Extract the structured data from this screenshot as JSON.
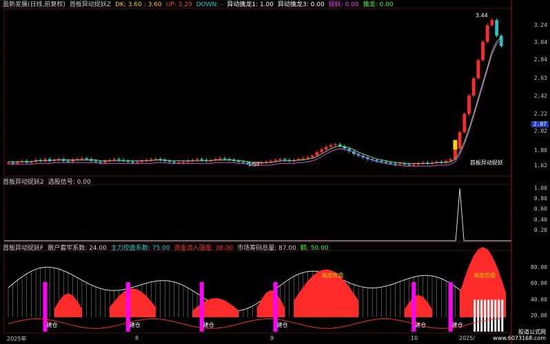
{
  "colors": {
    "up": "#ff2a2a",
    "down": "#22c6c6",
    "ma": "#d94cd9",
    "ma2": "#7ddc7d",
    "grid": "#5a1010",
    "text": "#c8c8c8",
    "magenta": "#ff00ff",
    "yellow": "#ffd000"
  },
  "panel1": {
    "header": [
      {
        "text": "盈新发展(日线,前复权)",
        "color": "#d0d0d0"
      },
      {
        "text": "首板异动捉妖Z",
        "color": "#d0d0d0"
      },
      {
        "text": "DK: 3.60 : 3.60",
        "color": "#ffd000"
      },
      {
        "text": "UP: 3.29",
        "color": "#ff4040"
      },
      {
        "text": "DOWN: -",
        "color": "#22d0d0"
      },
      {
        "text": "异动擒龙1: 1.00",
        "color": "#ffffff"
      },
      {
        "text": "异动擒龙3: 0.00",
        "color": "#ffffff"
      },
      {
        "text": "捉妖: 0.00",
        "color": "#ff40ff"
      },
      {
        "text": "擒龙: 0.00",
        "color": "#40ff40"
      }
    ],
    "price_label": "2.07",
    "peak_label": "3.44",
    "low_label": "1.57",
    "annotation": "首板异动捉妖"
  },
  "panel2": {
    "header": [
      {
        "text": "首板异动捉妖2",
        "color": "#d0d0d0"
      },
      {
        "text": "选股信号: 0.00",
        "color": "#d0d0d0"
      }
    ]
  },
  "panel3": {
    "header": [
      {
        "text": "首板异动捉妖F",
        "color": "#d0d0d0"
      },
      {
        "text": "散户套牢系数: 24.00",
        "color": "#d0d0d0"
      },
      {
        "text": "主力控盘系数: 75.00",
        "color": "#22d0d0"
      },
      {
        "text": "资金流入强度: 38.00",
        "color": "#ff3030"
      },
      {
        "text": "市场筹码总量: 87.00",
        "color": "#d0d0d0"
      },
      {
        "text": "鹤: 50.00",
        "color": "#40ff40"
      }
    ],
    "label_hot1": "高度控盘",
    "label_hot2": "高度控盘",
    "build_label": "建仓"
  },
  "x_axis": [
    "2025年",
    "8",
    "9",
    "10",
    "2025/"
  ],
  "watermark": [
    "股道公式网",
    "www.6073168.com"
  ],
  "chart_data": [
    {
      "type": "candlestick",
      "y_ticks": [
        1.62,
        1.8,
        2.02,
        2.22,
        2.42,
        2.63,
        2.84,
        3.04,
        3.24
      ],
      "ylim": [
        1.52,
        3.42
      ],
      "close": [
        1.66,
        1.65,
        1.67,
        1.68,
        1.66,
        1.67,
        1.69,
        1.68,
        1.7,
        1.68,
        1.69,
        1.7,
        1.68,
        1.67,
        1.69,
        1.7,
        1.71,
        1.7,
        1.68,
        1.67,
        1.66,
        1.68,
        1.69,
        1.7,
        1.69,
        1.68,
        1.67,
        1.66,
        1.67,
        1.68,
        1.69,
        1.7,
        1.7,
        1.69,
        1.68,
        1.67,
        1.66,
        1.66,
        1.67,
        1.68,
        1.69,
        1.7,
        1.69,
        1.68,
        1.69,
        1.7,
        1.71,
        1.7,
        1.69,
        1.68,
        1.67,
        1.66,
        1.65,
        1.64,
        1.65,
        1.66,
        1.67,
        1.68,
        1.69,
        1.7,
        1.69,
        1.68,
        1.69,
        1.7,
        1.71,
        1.72,
        1.74,
        1.78,
        1.81,
        1.84,
        1.86,
        1.87,
        1.85,
        1.82,
        1.79,
        1.76,
        1.74,
        1.72,
        1.7,
        1.69,
        1.68,
        1.67,
        1.66,
        1.65,
        1.64,
        1.65,
        1.64,
        1.63,
        1.64,
        1.65,
        1.66,
        1.65,
        1.66,
        1.67,
        1.66,
        1.68,
        1.7,
        1.82,
        2.01,
        2.22,
        2.43,
        2.63,
        2.84,
        3.05,
        3.24,
        3.3,
        3.12,
        3.0
      ],
      "ma": [
        1.67,
        1.67,
        1.67,
        1.67,
        1.67,
        1.67,
        1.68,
        1.68,
        1.68,
        1.68,
        1.69,
        1.69,
        1.69,
        1.69,
        1.69,
        1.69,
        1.69,
        1.69,
        1.69,
        1.69,
        1.68,
        1.68,
        1.68,
        1.68,
        1.68,
        1.68,
        1.68,
        1.68,
        1.68,
        1.68,
        1.68,
        1.68,
        1.69,
        1.69,
        1.69,
        1.68,
        1.68,
        1.68,
        1.68,
        1.68,
        1.68,
        1.68,
        1.68,
        1.68,
        1.68,
        1.69,
        1.69,
        1.69,
        1.69,
        1.69,
        1.68,
        1.68,
        1.67,
        1.66,
        1.66,
        1.66,
        1.66,
        1.66,
        1.67,
        1.68,
        1.68,
        1.68,
        1.68,
        1.69,
        1.69,
        1.7,
        1.71,
        1.73,
        1.76,
        1.79,
        1.82,
        1.84,
        1.85,
        1.84,
        1.83,
        1.81,
        1.78,
        1.76,
        1.74,
        1.72,
        1.7,
        1.69,
        1.68,
        1.67,
        1.66,
        1.66,
        1.65,
        1.65,
        1.65,
        1.65,
        1.65,
        1.65,
        1.65,
        1.66,
        1.66,
        1.66,
        1.67,
        1.7,
        1.78,
        1.9,
        2.05,
        2.22,
        2.4,
        2.58,
        2.76,
        2.94,
        3.05,
        3.1
      ]
    },
    {
      "type": "line",
      "name": "选股信号",
      "y_ticks": [
        0.2,
        0.4,
        0.6,
        0.8,
        1.0
      ],
      "ylim": [
        0,
        1.05
      ],
      "signal_index": 98
    },
    {
      "type": "area",
      "y_ticks": [
        20.0,
        40.0,
        60.0,
        80.0
      ],
      "ylim": [
        0,
        100
      ]
    }
  ]
}
